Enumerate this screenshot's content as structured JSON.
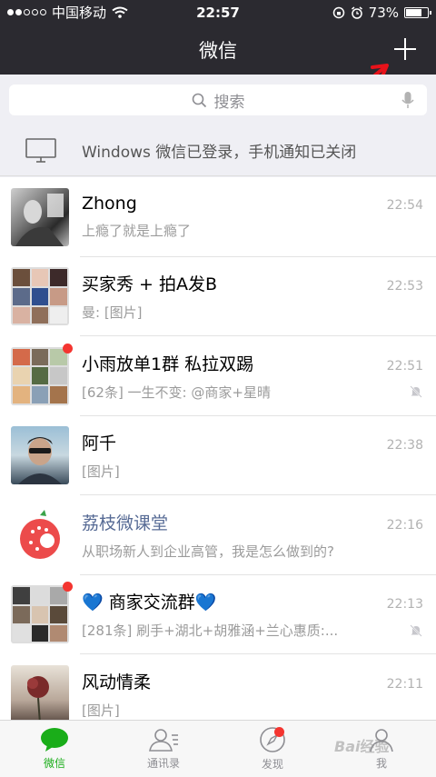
{
  "status": {
    "carrier": "中国移动",
    "time": "22:57",
    "battery": "73%",
    "battery_level": 0.73,
    "signal_icon": "signal-dots",
    "wifi_icon": "wifi-icon"
  },
  "header": {
    "title": "微信",
    "bg_color": "#2b2a30",
    "add_icon": "plus-icon"
  },
  "search": {
    "placeholder": "搜索"
  },
  "notice": {
    "text": "Windows 微信已登录，手机通知已关闭"
  },
  "chats": [
    {
      "name": "Zhong",
      "preview": "上瘾了就是上瘾了",
      "time": "22:54",
      "muted": false,
      "unread_dot": false
    },
    {
      "name": "买家秀 + 拍A发B",
      "preview": "曼: [图片]",
      "time": "22:53",
      "muted": false,
      "unread_dot": false
    },
    {
      "name": "小雨放单1群  私拉双踢",
      "preview": "[62条] 一生不变: @商家+星晴",
      "time": "22:51",
      "muted": true,
      "unread_dot": true
    },
    {
      "name": "阿千",
      "preview": "[图片]",
      "time": "22:38",
      "muted": false,
      "unread_dot": false
    },
    {
      "name": "荔枝微课堂",
      "preview": "从职场新人到企业高管，我是怎么做到的?",
      "time": "22:16",
      "muted": false,
      "unread_dot": false
    },
    {
      "name": "💙 商家交流群💙",
      "preview": "[281条] 刷手+湖北+胡雅涵+兰心惠质:...",
      "time": "22:13",
      "muted": true,
      "unread_dot": true
    },
    {
      "name": "风动情柔",
      "preview": "[图片]",
      "time": "22:11",
      "muted": false,
      "unread_dot": false
    }
  ],
  "tabs": [
    {
      "label": "微信",
      "icon": "chat-bubble-icon",
      "active": true
    },
    {
      "label": "通讯录",
      "icon": "contacts-icon",
      "active": false
    },
    {
      "label": "发现",
      "icon": "compass-icon",
      "active": false,
      "badge": true
    },
    {
      "label": "我",
      "icon": "person-icon",
      "active": false
    }
  ],
  "colors": {
    "accent": "#1aad19",
    "badge": "#f43530",
    "annotation_arrow": "#e8121a"
  }
}
